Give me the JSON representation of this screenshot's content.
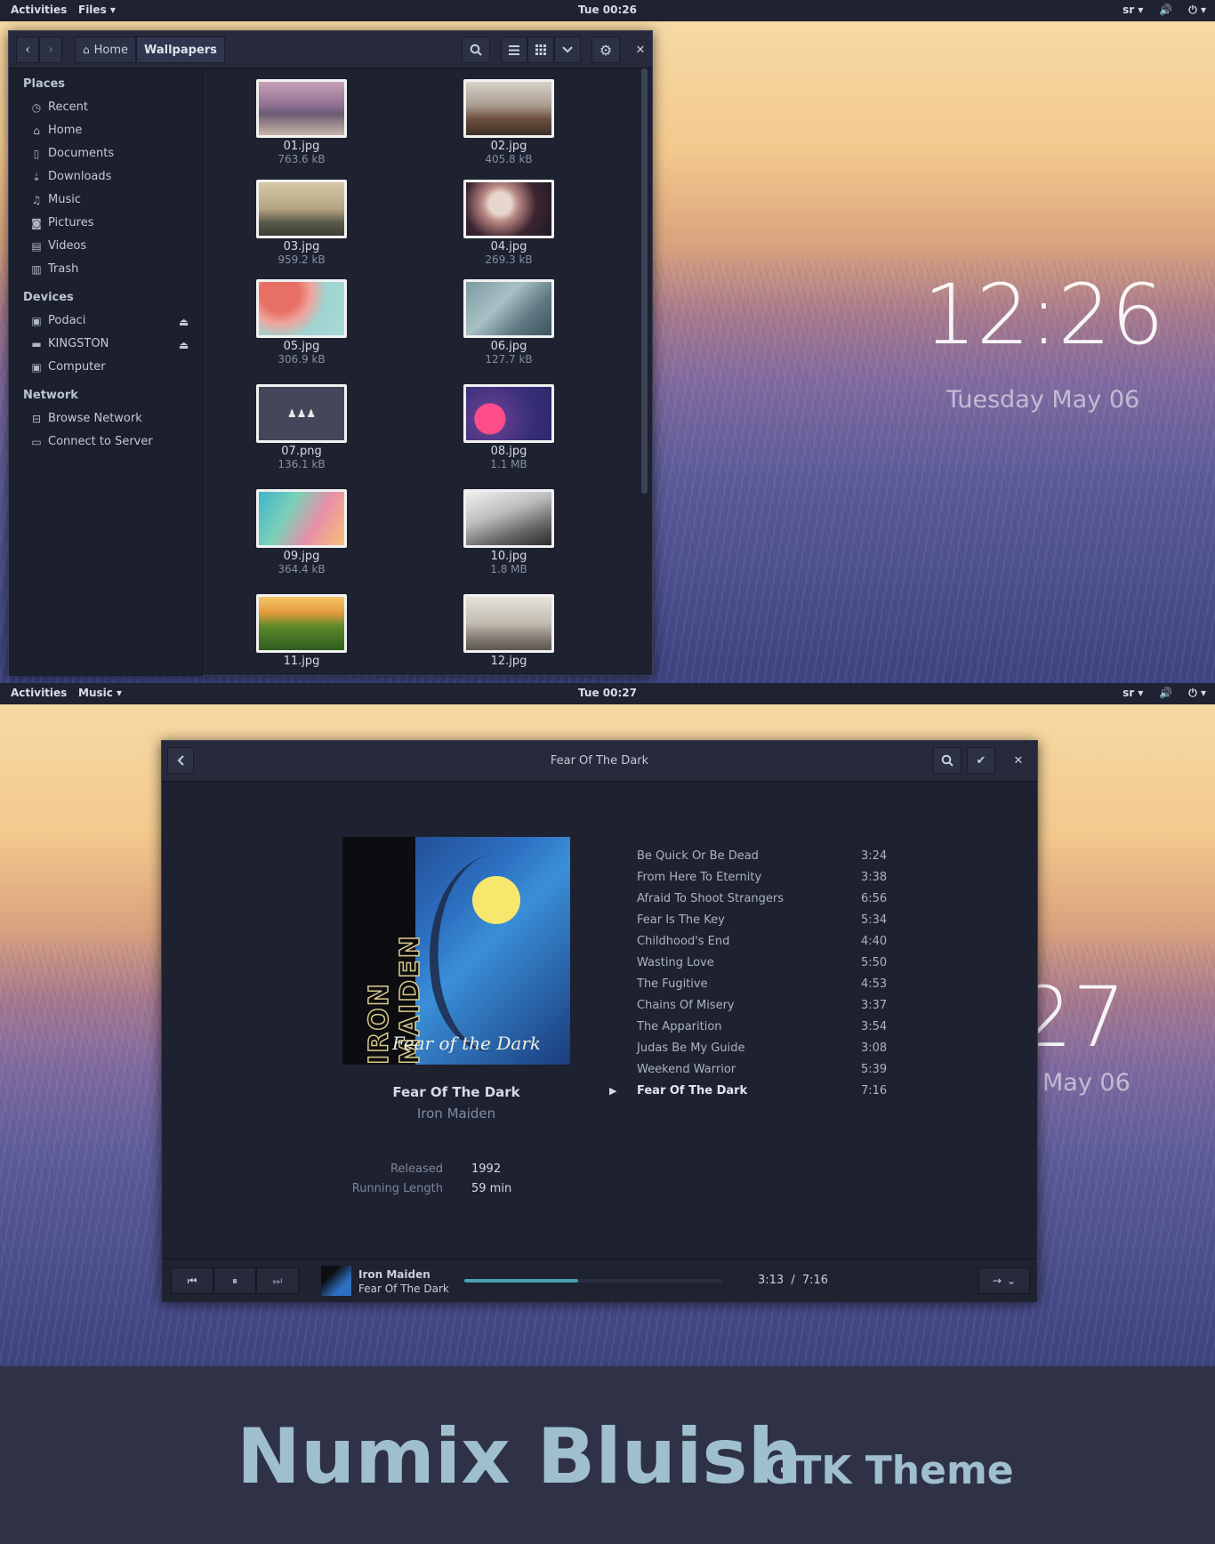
{
  "top_panel_1": {
    "activities": "Activities",
    "app_menu": "Files ▾",
    "clock": "Tue 00:26",
    "lang": "sr ▾",
    "volume": "🔊",
    "power": "⏻ ▾"
  },
  "top_panel_2": {
    "activities": "Activities",
    "app_menu": "Music ▾",
    "clock": "Tue 00:27",
    "lang": "sr ▾",
    "volume": "🔊",
    "power": "⏻ ▾"
  },
  "desktop_clock": {
    "time": "12:26",
    "date": "Tuesday May 06"
  },
  "desktop_clock_partial": {
    "time": "27",
    "date": "May 06"
  },
  "files": {
    "nav": {
      "back": "‹",
      "forward": "›"
    },
    "breadcrumbs": [
      {
        "icon": "home-icon",
        "label": "Home"
      },
      {
        "label": "Wallpapers"
      }
    ],
    "toolbar": {
      "search": "search-icon",
      "list": "list-view-icon",
      "grid": "grid-view-icon",
      "menu": "chevron-down-icon",
      "settings": "gear-icon",
      "close": "✕"
    },
    "sidebar": {
      "places_heading": "Places",
      "places": [
        "Recent",
        "Home",
        "Documents",
        "Downloads",
        "Music",
        "Pictures",
        "Videos",
        "Trash"
      ],
      "devices_heading": "Devices",
      "devices": [
        "Podaci",
        "KINGSTON",
        "Computer"
      ],
      "network_heading": "Network",
      "network": [
        "Browse Network",
        "Connect to Server"
      ]
    },
    "files": [
      {
        "name": "01.jpg",
        "size": "763.6 kB"
      },
      {
        "name": "02.jpg",
        "size": "405.8 kB"
      },
      {
        "name": "03.jpg",
        "size": "959.2 kB"
      },
      {
        "name": "04.jpg",
        "size": "269.3 kB"
      },
      {
        "name": "05.jpg",
        "size": "306.9 kB"
      },
      {
        "name": "06.jpg",
        "size": "127.7 kB"
      },
      {
        "name": "07.png",
        "size": "136.1 kB"
      },
      {
        "name": "08.jpg",
        "size": "1.1 MB"
      },
      {
        "name": "09.jpg",
        "size": "364.4 kB"
      },
      {
        "name": "10.jpg",
        "size": "1.8 MB"
      },
      {
        "name": "11.jpg",
        "size": ""
      },
      {
        "name": "12.jpg",
        "size": ""
      }
    ]
  },
  "music": {
    "title": "Fear Of The Dark",
    "album": {
      "title": "Fear Of The Dark",
      "artist": "Iron Maiden",
      "cover_band": "IRON MAIDEN",
      "cover_script": "Fear of the Dark"
    },
    "meta": [
      {
        "key": "Released",
        "value": "1992"
      },
      {
        "key": "Running Length",
        "value": "59 min"
      }
    ],
    "tracks": [
      {
        "name": "Be Quick Or Be Dead",
        "duration": "3:24"
      },
      {
        "name": "From Here To Eternity",
        "duration": "3:38"
      },
      {
        "name": "Afraid To Shoot Strangers",
        "duration": "6:56"
      },
      {
        "name": "Fear Is The Key",
        "duration": "5:34"
      },
      {
        "name": "Childhood's End",
        "duration": "4:40"
      },
      {
        "name": "Wasting Love",
        "duration": "5:50"
      },
      {
        "name": "The Fugitive",
        "duration": "4:53"
      },
      {
        "name": "Chains Of Misery",
        "duration": "3:37"
      },
      {
        "name": "The Apparition",
        "duration": "3:54"
      },
      {
        "name": "Judas Be My Guide",
        "duration": "3:08"
      },
      {
        "name": "Weekend Warrior",
        "duration": "5:39"
      },
      {
        "name": "Fear Of The Dark",
        "duration": "7:16",
        "playing": true
      }
    ],
    "player": {
      "prev": "⏮",
      "pause": "⏸",
      "next": "⏭",
      "artist": "Iron Maiden",
      "track": "Fear Of The Dark",
      "elapsed": "3:13",
      "separator": "/",
      "total": "7:16",
      "progress": 0.44,
      "repeat": "→",
      "menu": "⌄"
    }
  },
  "banner": {
    "title": "Numix Bluish",
    "subtitle": "GTK Theme"
  },
  "colors": {
    "accent": "#46a1b0",
    "window_bg": "#1e2130",
    "header_bg": "#262a3b",
    "banner_text": "#9fbfcd"
  }
}
